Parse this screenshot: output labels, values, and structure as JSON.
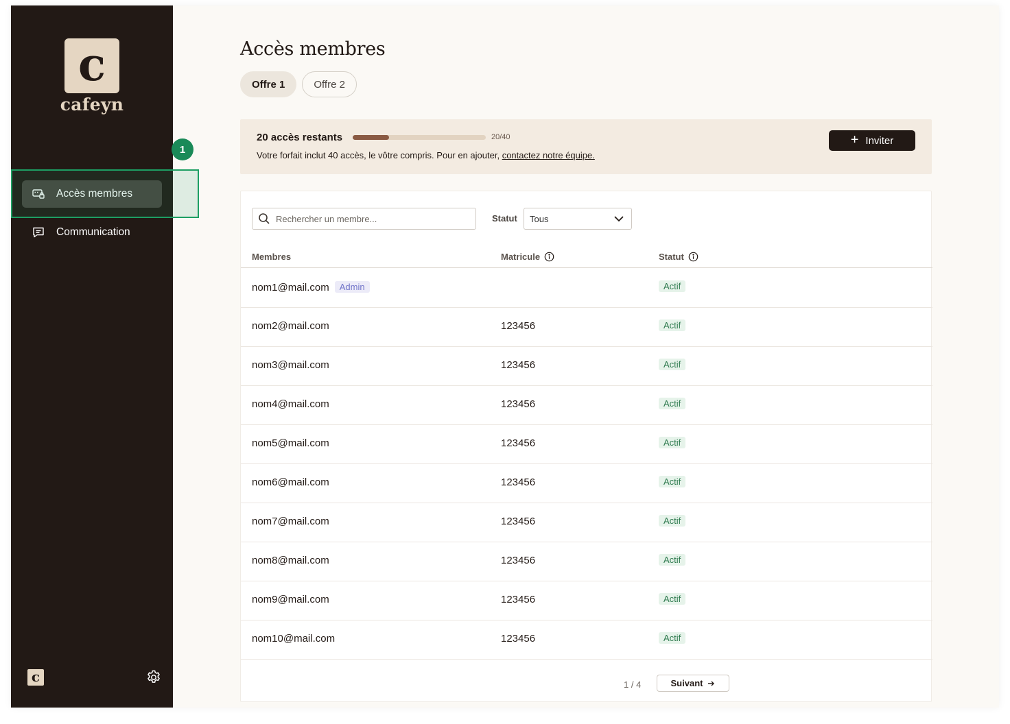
{
  "app": {
    "logo_letter": "c",
    "logo_text": "cafeyn"
  },
  "sidebar": {
    "items": [
      {
        "label": "Accès membres",
        "icon": "members-access-icon",
        "active": true
      },
      {
        "label": "Communication",
        "icon": "chat-icon",
        "active": false
      }
    ],
    "step_badge": "1",
    "bottom_logo_letter": "c",
    "settings_icon": "gear-icon"
  },
  "page": {
    "title": "Accès membres",
    "tabs": [
      {
        "label": "Offre 1",
        "active": true
      },
      {
        "label": "Offre 2",
        "active": false
      }
    ]
  },
  "banner": {
    "title": "20 accès restants",
    "progress_used": 20,
    "progress_total": 40,
    "progress_label": "20/40",
    "text": "Votre forfait inclut 40 accès, le vôtre compris. Pour en ajouter, ",
    "link": "contactez notre équipe.",
    "invite_label": "Inviter"
  },
  "filters": {
    "search_placeholder": "Rechercher un membre...",
    "status_label": "Statut",
    "status_value": "Tous"
  },
  "table": {
    "columns": [
      "Membres",
      "Matricule",
      "Statut"
    ],
    "rows": [
      {
        "email": "nom1@mail.com",
        "badge": "Admin",
        "matricule": "",
        "status": "Actif"
      },
      {
        "email": "nom2@mail.com",
        "badge": "",
        "matricule": "123456",
        "status": "Actif"
      },
      {
        "email": "nom3@mail.com",
        "badge": "",
        "matricule": "123456",
        "status": "Actif"
      },
      {
        "email": "nom4@mail.com",
        "badge": "",
        "matricule": "123456",
        "status": "Actif"
      },
      {
        "email": "nom5@mail.com",
        "badge": "",
        "matricule": "123456",
        "status": "Actif"
      },
      {
        "email": "nom6@mail.com",
        "badge": "",
        "matricule": "123456",
        "status": "Actif"
      },
      {
        "email": "nom7@mail.com",
        "badge": "",
        "matricule": "123456",
        "status": "Actif"
      },
      {
        "email": "nom8@mail.com",
        "badge": "",
        "matricule": "123456",
        "status": "Actif"
      },
      {
        "email": "nom9@mail.com",
        "badge": "",
        "matricule": "123456",
        "status": "Actif"
      },
      {
        "email": "nom10@mail.com",
        "badge": "",
        "matricule": "123456",
        "status": "Actif"
      }
    ]
  },
  "pagination": {
    "page_info": "1 / 4",
    "next_label": "Suivant"
  },
  "colors": {
    "sidebar_bg": "#221915",
    "accent_brown": "#8a5a43",
    "highlight_green": "#1d9e63",
    "status_green": "#2e7a4e",
    "admin_purple": "#7275c9"
  }
}
